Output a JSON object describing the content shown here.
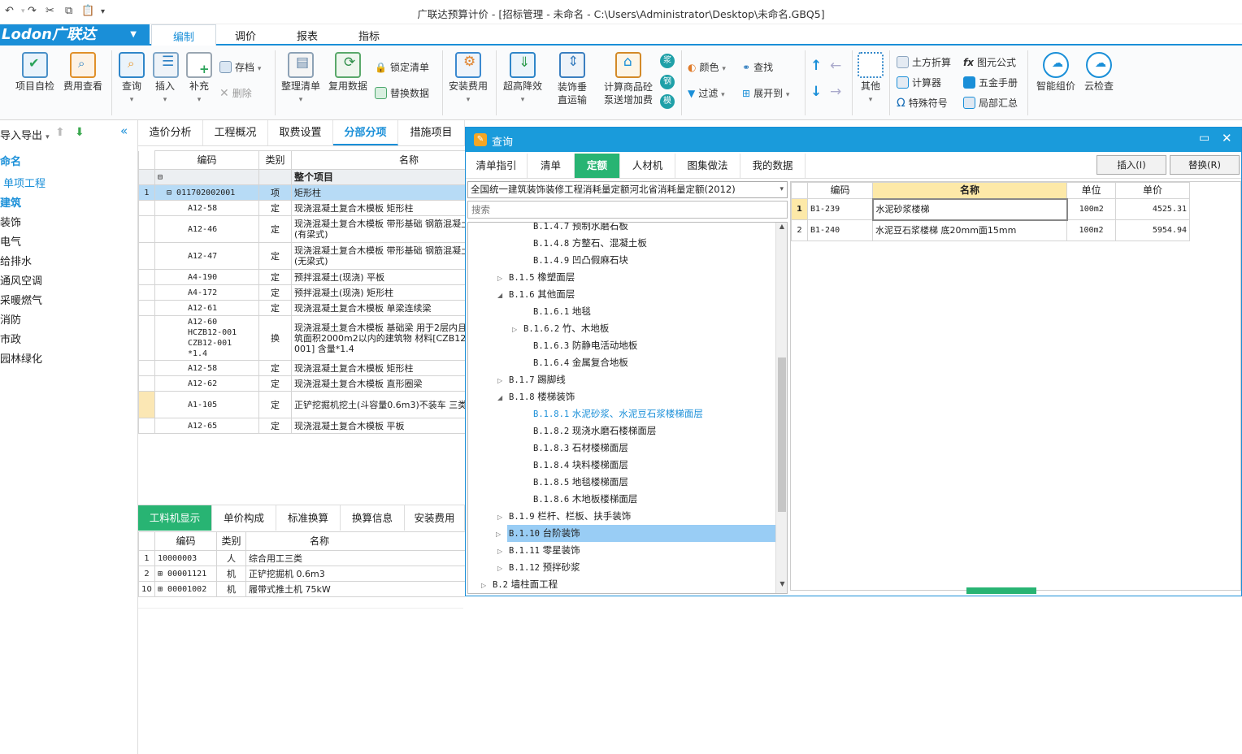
{
  "window": {
    "title": "广联达预算计价 - [招标管理 - 未命名 - C:\\Users\\Administrator\\Desktop\\未命名.GBQ5]"
  },
  "quick_access": {
    "undo": "↶",
    "redo": "↷",
    "cut": "✂",
    "copy": "⧉",
    "paste": "📋",
    "more": "▾"
  },
  "app": {
    "logo": "Lodon广联达"
  },
  "main_tabs": [
    "编制",
    "调价",
    "报表",
    "指标"
  ],
  "ribbon": {
    "big_buttons": [
      {
        "label": "项目自检",
        "icon": "self-check-icon"
      },
      {
        "label": "费用查看",
        "icon": "fee-view-icon"
      },
      {
        "label": "查询",
        "icon": "query-icon"
      },
      {
        "label": "插入",
        "icon": "insert-icon"
      },
      {
        "label": "补充",
        "icon": "supplement-icon"
      },
      {
        "label": "整理清单",
        "icon": "organize-list-icon"
      },
      {
        "label": "复用数据",
        "icon": "reuse-data-icon"
      },
      {
        "label": "安装费用",
        "icon": "install-fee-icon"
      },
      {
        "label": "超高降效",
        "icon": "height-efficiency-icon"
      },
      {
        "label": "装饰垂直运输",
        "icon": "vertical-transport-icon"
      },
      {
        "label": "计算商品砼泵送增加费",
        "icon": "concrete-pump-icon"
      },
      {
        "label": "其他",
        "icon": "grid-icon"
      },
      {
        "label": "智能组价",
        "icon": "cloud-icon"
      },
      {
        "label": "云检查",
        "icon": "cloud-check-icon"
      }
    ],
    "small_buttons": {
      "save": "存档",
      "delete": "删除",
      "lock_list": "锁定清单",
      "replace_data": "替换数据",
      "color": "颜色",
      "find": "查找",
      "filter": "过滤",
      "expand_to": "展开到",
      "earthwork": "土方折算",
      "calculator": "计算器",
      "special_symbol": "特殊符号",
      "element_formula": "图元公式",
      "hardware_manual": "五金手册",
      "partial_summary": "局部汇总"
    },
    "round_badges": [
      "浆",
      "钢",
      "模"
    ]
  },
  "left_panel": {
    "import_export": "导入导出",
    "items": [
      "命名",
      "单项工程",
      "建筑",
      "装饰",
      "电气",
      "给排水",
      "通风空调",
      "采暖燃气",
      "消防",
      "市政",
      "园林绿化"
    ]
  },
  "center_tabs": [
    "造价分析",
    "工程概况",
    "取费设置",
    "分部分项",
    "措施项目"
  ],
  "center_grid": {
    "headers": [
      "编码",
      "类别",
      "名称"
    ],
    "rows": [
      {
        "idx": "",
        "code": "",
        "type": "",
        "name": "整个项目",
        "kind": "root"
      },
      {
        "idx": "1",
        "code": "011702002001",
        "type": "项",
        "name": "矩形柱",
        "kind": "item"
      },
      {
        "idx": "",
        "code": "A12-58",
        "type": "定",
        "name": "现浇混凝土复合木模板 矩形柱",
        "kind": "sub"
      },
      {
        "idx": "",
        "code": "A12-46",
        "type": "定",
        "name": "现浇混凝土复合木模板 带形基础 钢筋混凝土(有梁式)",
        "kind": "sub2"
      },
      {
        "idx": "",
        "code": "A12-47",
        "type": "定",
        "name": "现浇混凝土复合木模板 带形基础 钢筋混凝土(无梁式)",
        "kind": "sub2"
      },
      {
        "idx": "",
        "code": "A4-190",
        "type": "定",
        "name": "预拌混凝土(现浇) 平板",
        "kind": "sub"
      },
      {
        "idx": "",
        "code": "A4-172",
        "type": "定",
        "name": "预拌混凝土(现浇) 矩形柱",
        "kind": "sub"
      },
      {
        "idx": "",
        "code": "A12-61",
        "type": "定",
        "name": "现浇混凝土复合木模板 单梁连续梁",
        "kind": "sub"
      },
      {
        "idx": "",
        "code": "A12-60 HCZB12-001 CZB12-001 *1.4",
        "type": "换",
        "name": "现浇混凝土复合木模板 基础梁 用于2层内且建筑面积2000m2以内的建筑物 材料[CZB12-001] 含量*1.4",
        "kind": "sub3"
      },
      {
        "idx": "",
        "code": "A12-58",
        "type": "定",
        "name": "现浇混凝土复合木模板 矩形柱",
        "kind": "sub"
      },
      {
        "idx": "",
        "code": "A12-62",
        "type": "定",
        "name": "现浇混凝土复合木模板 直形圈梁",
        "kind": "sub"
      },
      {
        "idx": "",
        "code": "A1-105",
        "type": "定",
        "name": "正铲挖掘机挖土(斗容量0.6m3)不装车 三类土",
        "kind": "sub2y"
      },
      {
        "idx": "",
        "code": "A12-65",
        "type": "定",
        "name": "现浇混凝土复合木模板 平板",
        "kind": "sub"
      }
    ]
  },
  "bottom_tabs": [
    "工料机显示",
    "单价构成",
    "标准换算",
    "换算信息",
    "安装费用"
  ],
  "bottom_grid": {
    "headers": [
      "编码",
      "类别",
      "名称"
    ],
    "rows": [
      {
        "idx": "1",
        "code": "10000003",
        "type": "人",
        "name": "综合用工三类",
        "expand": false
      },
      {
        "idx": "2",
        "code": "00001121",
        "type": "机",
        "name": "正铲挖掘机 0.6m3",
        "expand": true
      },
      {
        "idx": "10",
        "code": "00001002",
        "type": "机",
        "name": "履带式推土机 75kW",
        "expand": true
      }
    ]
  },
  "dialog": {
    "title": "查询",
    "tabs": [
      "清单指引",
      "清单",
      "定额",
      "人材机",
      "图集做法",
      "我的数据"
    ],
    "insert_button": "插入(I)",
    "replace_button": "替换(R)",
    "dropdown_value": "全国统一建筑装饰装修工程消耗量定额河北省消耗量定额(2012)",
    "search_placeholder": "搜索",
    "tree": [
      {
        "code": "B.1.4.7",
        "label": "预制水磨石板",
        "level": 2,
        "exp": ""
      },
      {
        "code": "B.1.4.8",
        "label": "方整石、混凝土板",
        "level": 2,
        "exp": ""
      },
      {
        "code": "B.1.4.9",
        "label": "凹凸假麻石块",
        "level": 2,
        "exp": ""
      },
      {
        "code": "B.1.5",
        "label": "橡塑面层",
        "level": 1,
        "exp": "▷"
      },
      {
        "code": "B.1.6",
        "label": "其他面层",
        "level": 1,
        "exp": "◢"
      },
      {
        "code": "B.1.6.1",
        "label": "地毯",
        "level": 2,
        "exp": ""
      },
      {
        "code": "B.1.6.2",
        "label": "竹、木地板",
        "level": 2,
        "exp": "▷"
      },
      {
        "code": "B.1.6.3",
        "label": "防静电活动地板",
        "level": 2,
        "exp": ""
      },
      {
        "code": "B.1.6.4",
        "label": "金属复合地板",
        "level": 2,
        "exp": ""
      },
      {
        "code": "B.1.7",
        "label": "踢脚线",
        "level": 1,
        "exp": "▷"
      },
      {
        "code": "B.1.8",
        "label": "楼梯装饰",
        "level": 1,
        "exp": "◢"
      },
      {
        "code": "B.1.8.1",
        "label": "水泥砂浆、水泥豆石浆楼梯面层",
        "level": 2,
        "exp": "",
        "state": "link"
      },
      {
        "code": "B.1.8.2",
        "label": "现浇水磨石楼梯面层",
        "level": 2,
        "exp": ""
      },
      {
        "code": "B.1.8.3",
        "label": "石材楼梯面层",
        "level": 2,
        "exp": ""
      },
      {
        "code": "B.1.8.4",
        "label": "块料楼梯面层",
        "level": 2,
        "exp": ""
      },
      {
        "code": "B.1.8.5",
        "label": "地毯楼梯面层",
        "level": 2,
        "exp": ""
      },
      {
        "code": "B.1.8.6",
        "label": "木地板楼梯面层",
        "level": 2,
        "exp": ""
      },
      {
        "code": "B.1.9",
        "label": "栏杆、栏板、扶手装饰",
        "level": 1,
        "exp": "▷"
      },
      {
        "code": "B.1.10",
        "label": "台阶装饰",
        "level": 1,
        "exp": "▷",
        "state": "selected"
      },
      {
        "code": "B.1.11",
        "label": "零星装饰",
        "level": 1,
        "exp": "▷"
      },
      {
        "code": "B.1.12",
        "label": "预拌砂浆",
        "level": 1,
        "exp": "▷"
      },
      {
        "code": "B.2",
        "label": "墙柱面工程",
        "level": 0,
        "exp": "▷"
      }
    ],
    "result_headers": [
      "编码",
      "名称",
      "单位",
      "单价"
    ],
    "results": [
      {
        "idx": "1",
        "code": "B1-239",
        "name": "水泥砂浆楼梯",
        "unit": "100m2",
        "price": "4525.31"
      },
      {
        "idx": "2",
        "code": "B1-240",
        "name": "水泥豆石浆楼梯 底20mm面15mm",
        "unit": "100m2",
        "price": "5954.94"
      }
    ]
  },
  "colors": {
    "accent": "#1a8fd8",
    "green": "#28b473",
    "selected": "#99cdf5",
    "yellow": "#fbe7b4",
    "header": "#fde9a8"
  }
}
